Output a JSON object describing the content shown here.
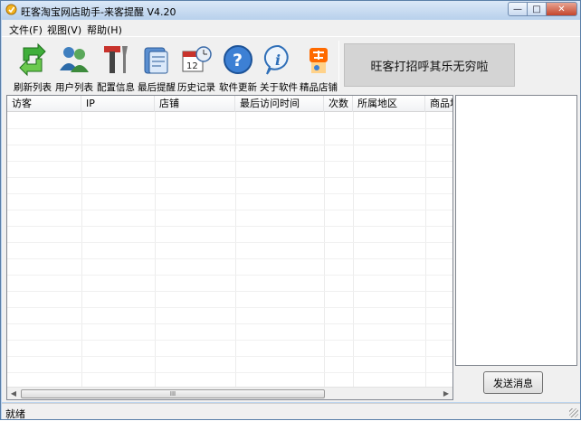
{
  "window": {
    "title": "旺客淘宝网店助手-来客提醒 V4.20"
  },
  "window_controls": {
    "minimize": "—",
    "maximize": "□",
    "close": "✕"
  },
  "menubar": {
    "items": [
      "文件(F)",
      "视图(V)",
      "帮助(H)"
    ]
  },
  "toolbar": {
    "buttons": [
      {
        "label": "刷新列表",
        "icon": "refresh-icon"
      },
      {
        "label": "用户列表",
        "icon": "users-icon"
      },
      {
        "label": "配置信息",
        "icon": "tools-icon"
      },
      {
        "label": "最后提醒",
        "icon": "notes-icon"
      },
      {
        "label": "历史记录",
        "icon": "calendar-icon"
      },
      {
        "label": "软件更新",
        "icon": "help-icon"
      },
      {
        "label": "关于软件",
        "icon": "info-icon"
      },
      {
        "label": "精品店铺",
        "icon": "taobao-icon"
      }
    ],
    "banner_text": "旺客打招呼其乐无穷啦"
  },
  "table": {
    "columns": [
      "访客",
      "IP",
      "店铺",
      "最后访问时间",
      "次数",
      "所属地区",
      "商品地"
    ],
    "rows": []
  },
  "scrollbar": {
    "thumb_grip": "III"
  },
  "side": {
    "send_label": "发送消息"
  },
  "status": {
    "text": "就绪"
  },
  "colors": {
    "titlebar": "#c4d8ef",
    "close_button": "#c4452c",
    "face": "#f0f0f0"
  }
}
